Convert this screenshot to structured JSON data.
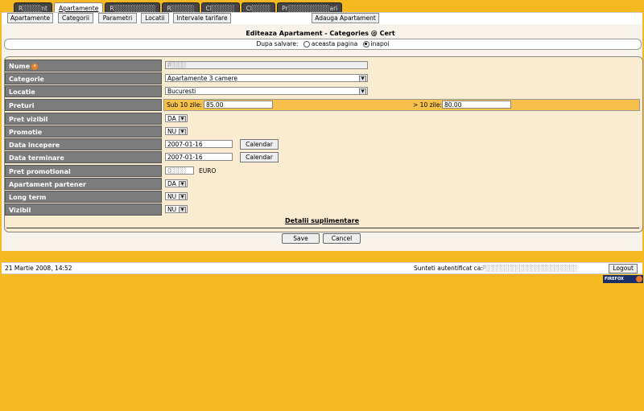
{
  "top_tabs": [
    {
      "label": "R░░░░nt",
      "active": false
    },
    {
      "label": "Apartamente",
      "active": true
    },
    {
      "label": "R░░░░░░░░░",
      "active": false
    },
    {
      "label": "R░░░░░",
      "active": false
    },
    {
      "label": "Cl░░░░░",
      "active": false
    },
    {
      "label": "Cl░░░░",
      "active": false
    },
    {
      "label": "Pr░░░░░░░░░ari",
      "active": false
    }
  ],
  "sub_nav": {
    "apartamente": "Apartamente",
    "categorii": "Categorii",
    "parametri": "Parametri",
    "locatii": "Locatii",
    "intervale": "Intervale tarifare",
    "adauga": "Adauga Apartament"
  },
  "panel": {
    "title": "Editeaza Apartament - Categories @ Cert",
    "save_label": "Dupa salvare:",
    "opt_this": "aceasta pagina",
    "opt_back": "inapoi",
    "selected": "inapoi"
  },
  "form": {
    "nume": {
      "label": "Nume",
      "value": "P░░░░"
    },
    "categorie": {
      "label": "Categorie",
      "value": "Apartamente 3 camere"
    },
    "locatie": {
      "label": "Locatie",
      "value": "Bucuresti"
    },
    "preturi": {
      "label": "Preturi",
      "sub_label": "Sub 10 zile:",
      "sub_value": "85.00",
      "over_label": "> 10 zile:",
      "over_value": "80.00"
    },
    "pret_vizibil": {
      "label": "Pret vizibil",
      "value": "DA"
    },
    "promotie": {
      "label": "Promotie",
      "value": "NU"
    },
    "data_incepere": {
      "label": "Data incepere",
      "value": "2007-01-16",
      "button": "Calendar"
    },
    "data_terminare": {
      "label": "Data terminare",
      "value": "2007-01-16",
      "button": "Calendar"
    },
    "pret_promotional": {
      "label": "Pret promotional",
      "value": "0░░░░",
      "unit": "EURO"
    },
    "apartament_partener": {
      "label": "Apartament partener",
      "value": "DA"
    },
    "long_term": {
      "label": "Long term",
      "value": "NU"
    },
    "vizibil": {
      "label": "Vizibil",
      "value": "NU"
    }
  },
  "details_link": "Detalii suplimentare",
  "actions": {
    "save": "Save",
    "cancel": "Cancel"
  },
  "status": {
    "datetime": "21 Martie 2008, 14:52",
    "auth_label": "Sunteti autentificat ca:",
    "auth_user": "P░░░░░░░░░░░░░░░░░░░░░░░░",
    "logout": "Logout"
  },
  "badge": "FIREFOX"
}
